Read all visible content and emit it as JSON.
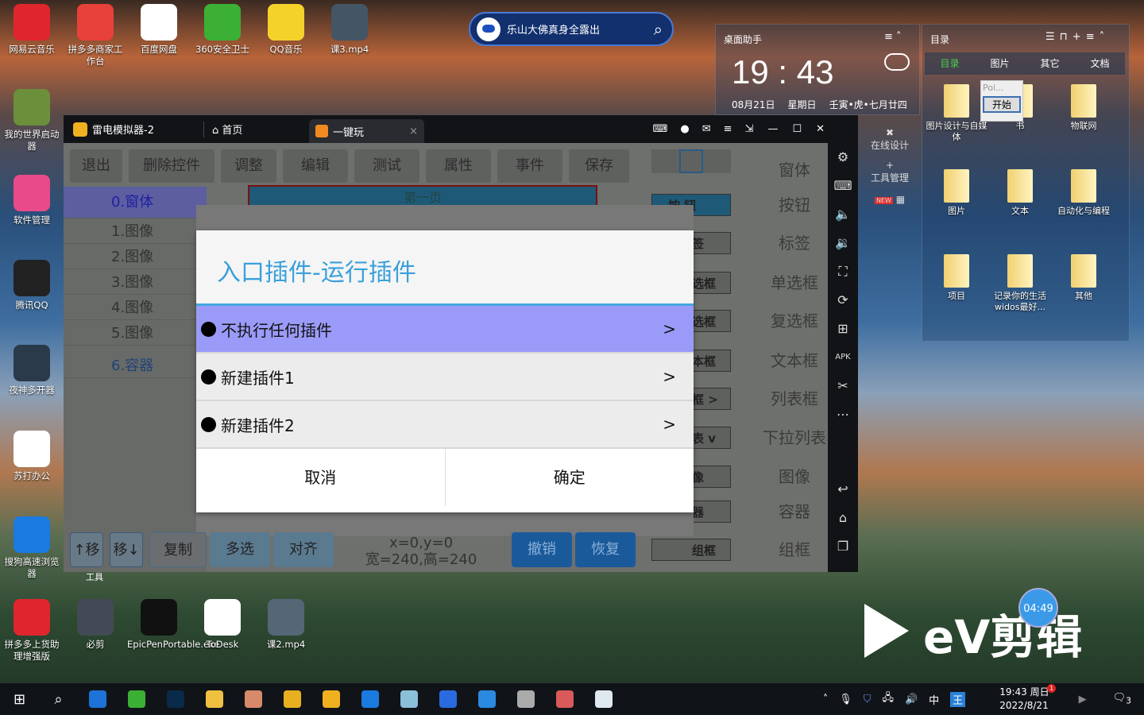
{
  "desktop": {
    "top_icons": [
      {
        "label": "网易云音乐",
        "color": "#e0262d"
      },
      {
        "label": "拼多多商家工作台",
        "color": "#e8403a"
      },
      {
        "label": "百度网盘",
        "color": "#ffffff"
      },
      {
        "label": "360安全卫士",
        "color": "#3cb034"
      },
      {
        "label": "QQ音乐",
        "color": "#f5d22a"
      },
      {
        "label": "课3.mp4",
        "color": "#445566"
      }
    ],
    "left_icons": [
      {
        "label": "我的世界启动器",
        "color": "#6b8f3a"
      },
      {
        "label": "软件管理",
        "color": "#e84a8a"
      },
      {
        "label": "腾讯QQ",
        "color": "#222222"
      },
      {
        "label": "夜神多开器",
        "color": "#2a3a4a"
      },
      {
        "label": "苏打办公",
        "color": "#ffffff"
      },
      {
        "label": "搜狗高速浏览器",
        "color": "#1a7ae0"
      },
      {
        "label": "拼多多上货助理增强版",
        "color": "#e0262d"
      }
    ],
    "bottom_icons": [
      {
        "label": "必剪",
        "color": "#444a55"
      },
      {
        "label": "EpicPenPortable.exe",
        "color": "#111111"
      },
      {
        "label": "ToDesk",
        "color": "#ffffff"
      },
      {
        "label": "课2.mp4",
        "color": "#556677"
      }
    ],
    "partial_label": "工具"
  },
  "search": {
    "text": "乐山大佛真身全露出"
  },
  "assistant": {
    "title": "桌面助手",
    "time": "19 : 43",
    "date": "08月21日",
    "weekday": "星期日",
    "lunar": "壬寅•虎•七月廿四",
    "tools": [
      {
        "label": "在线设计"
      },
      {
        "label": "工具管理"
      }
    ],
    "new_badge": "NEW"
  },
  "catalog": {
    "title": "目录",
    "tabs": [
      "目录",
      "图片",
      "其它",
      "文档"
    ],
    "active_tab": "目录",
    "popup_text": "Poi...",
    "popup_button": "开始",
    "items": [
      {
        "label": "图片设计与自媒体"
      },
      {
        "label": "书"
      },
      {
        "label": "物联网"
      },
      {
        "label": "图片"
      },
      {
        "label": "文本"
      },
      {
        "label": "自动化与编程"
      },
      {
        "label": "项目"
      },
      {
        "label": "记录你的生活widos最好..."
      },
      {
        "label": "其他"
      }
    ]
  },
  "emulator": {
    "app_name": "雷电模拟器-2",
    "tabs": [
      {
        "label": "首页"
      },
      {
        "label": "一键玩"
      }
    ],
    "toolbar": [
      "退出",
      "删除控件",
      "调整",
      "编辑",
      "测试",
      "属性",
      "事件",
      "保存"
    ],
    "list": [
      "0.窗体",
      "1.图像",
      "2.图像",
      "3.图像",
      "4.图像",
      "5.图像",
      "6.容器"
    ],
    "canvas_label": "第一页",
    "palette": [
      "窗体",
      "按钮",
      "标签",
      "单选框",
      "复选框",
      "文本框",
      "列表框",
      "下拉列表",
      "图像",
      "容器",
      "组框"
    ],
    "palette_previews": [
      "按 钮",
      "签",
      "选框",
      "选框",
      "本框",
      "框 >",
      "表 v",
      "像",
      "器",
      "组框"
    ],
    "bottom": {
      "move_up": "↑移",
      "move_down": "移↓",
      "copy": "复制",
      "multi": "多选",
      "align": "对齐",
      "coords": "x=0,y=0",
      "size": "宽=240,高=240",
      "undo": "撤销",
      "redo": "恢复"
    },
    "dialog": {
      "title": "入口插件-运行插件",
      "options": [
        {
          "label": "不执行任何插件",
          "selected": true
        },
        {
          "label": "新建插件1",
          "selected": false
        },
        {
          "label": "新建插件2",
          "selected": false
        }
      ],
      "arrow": ">",
      "cancel": "取消",
      "ok": "确定"
    }
  },
  "watermark": {
    "brand": "eV剪辑",
    "timer": "04:49"
  },
  "taskbar": {
    "time": "19:43 周日",
    "date": "2022/8/21",
    "ime": "中",
    "notif_badge": "1",
    "action_center_count": "3",
    "apps": [
      {
        "name": "ie-icon",
        "color": "#1e73d8"
      },
      {
        "name": "360-browser-icon",
        "color": "#3cb034"
      },
      {
        "name": "photoshop-icon",
        "color": "#0a2a4a"
      },
      {
        "name": "file-explorer-icon",
        "color": "#f0c040"
      },
      {
        "name": "avatar-app-icon",
        "color": "#d88a6a"
      },
      {
        "name": "app-yellow-icon",
        "color": "#e8b020"
      },
      {
        "name": "ldplayer-icon",
        "color": "#f0b020"
      },
      {
        "name": "sogou-icon",
        "color": "#1a7ae0"
      },
      {
        "name": "notepad-icon",
        "color": "#8ac0d8"
      },
      {
        "name": "shield-icon",
        "color": "#2a6ae0"
      },
      {
        "name": "ev-player-icon",
        "color": "#2a8ae0"
      },
      {
        "name": "calculator-icon",
        "color": "#aaaaaa"
      },
      {
        "name": "paint-icon",
        "color": "#d85a5a"
      },
      {
        "name": "puzzle-icon",
        "color": "#e0e8f0"
      }
    ]
  }
}
